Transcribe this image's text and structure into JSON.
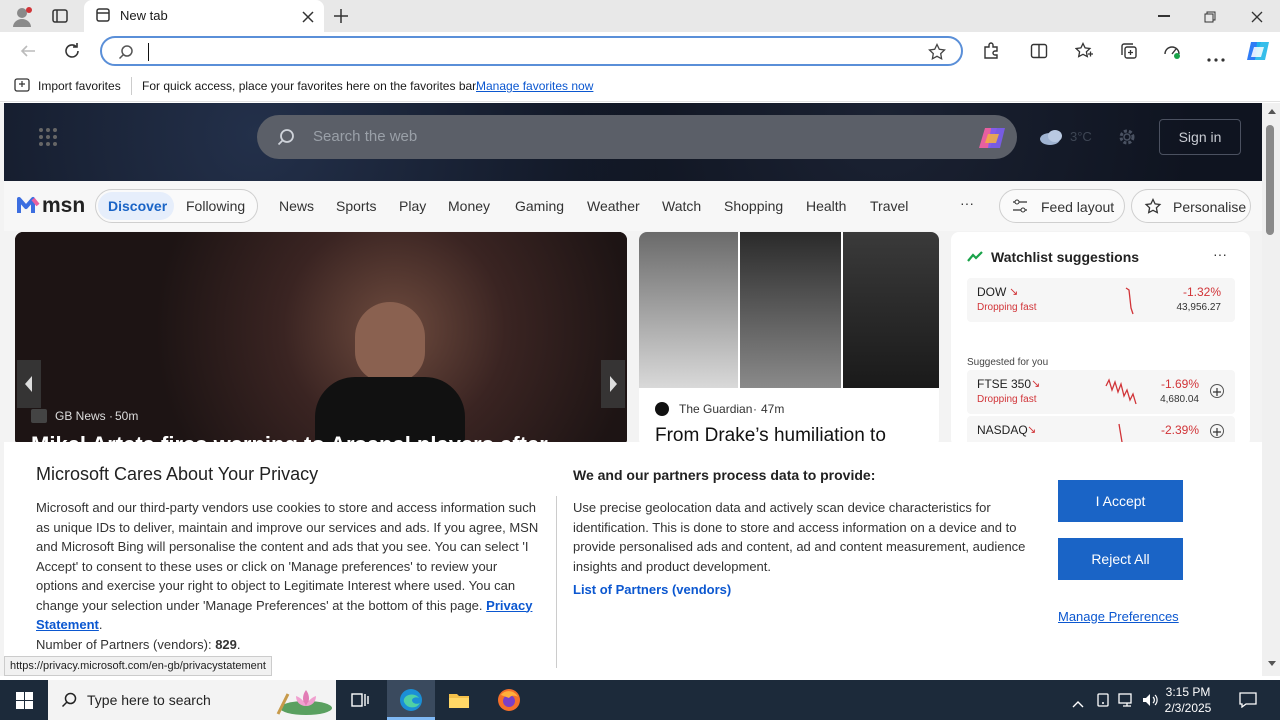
{
  "browser": {
    "tab_title": "New tab",
    "favorites_bar": {
      "import_label": "Import favorites",
      "hint_text": "For quick access, place your favorites here on the favorites bar.",
      "manage_link": "Manage favorites now"
    }
  },
  "msn": {
    "search_placeholder": "Search the web",
    "weather_temp": "3°C",
    "sign_in": "Sign in",
    "logo_text": "msn",
    "tabs": [
      "Discover",
      "Following"
    ],
    "nav_items": [
      "News",
      "Sports",
      "Play",
      "Money",
      "Gaming",
      "Weather",
      "Watch",
      "Shopping",
      "Health",
      "Travel"
    ],
    "more": "···",
    "feed_layout": "Feed layout",
    "personalise": "Personalise",
    "hero_story": {
      "source": "GB News",
      "age": "50m",
      "headline": "Mikel Arteta fires warning to Arsenal players after"
    },
    "second_story": {
      "source": "The Guardian",
      "age": "47m",
      "headline": "From Drake’s humiliation to"
    },
    "watchlist": {
      "title": "Watchlist suggestions",
      "suggested_label": "Suggested for you",
      "items": [
        {
          "name": "DOW",
          "status": "Dropping fast",
          "change": "-1.32%",
          "value": "43,956.27"
        },
        {
          "name": "FTSE 350",
          "status": "Dropping fast",
          "change": "-1.69%",
          "value": "4,680.04"
        },
        {
          "name": "NASDAQ",
          "status": "",
          "change": "-2.39%",
          "value": ""
        }
      ]
    }
  },
  "privacy": {
    "title": "Microsoft Cares About Your Privacy",
    "body": "Microsoft and our third-party vendors use cookies to store and access information such as unique IDs to deliver, maintain and improve our services and ads. If you agree, MSN and Microsoft Bing will personalise the content and ads that you see. You can select 'I Accept' to consent to these uses or click on 'Manage preferences' to review your options and exercise your right to object to Legitimate Interest where used.  You can change your selection under 'Manage Preferences' at the bottom of this page.",
    "privacy_link": "Privacy Statement",
    "partners_count_label": "Number of Partners (vendors):",
    "partners_count": "829",
    "process_title": "We and our partners process data to provide:",
    "process_body": "Use precise geolocation data and actively scan device characteristics for identification. This is done to store and access information on a device and to provide personalised ads and content, ad and content measurement, audience insights and product development.",
    "partners_link": "List of Partners (vendors)",
    "accept": "I Accept",
    "reject": "Reject All",
    "manage": "Manage Preferences"
  },
  "status_url": "https://privacy.microsoft.com/en-gb/privacystatement",
  "taskbar": {
    "search_placeholder": "Type here to search",
    "time": "3:15 PM",
    "date": "2/3/2025"
  },
  "colors": {
    "accent": "#1a64c6",
    "link": "#0b57d0",
    "loss": "#d13438",
    "taskbar": "#1c2a3a"
  }
}
